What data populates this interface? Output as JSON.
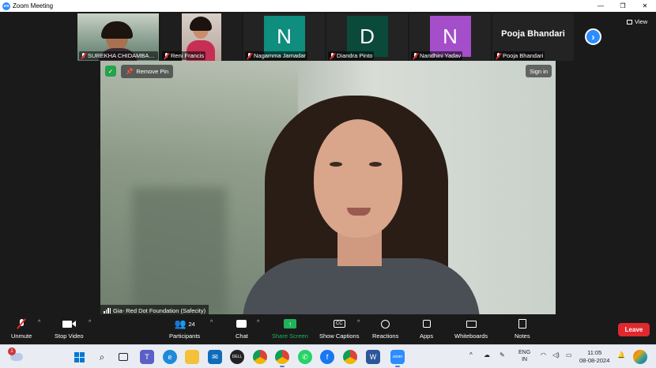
{
  "window": {
    "title": "Zoom Meeting",
    "controls": {
      "minimize": "—",
      "restore": "❐",
      "close": "✕"
    }
  },
  "gallery": {
    "participants": [
      {
        "name": "SUREKHA CHIDAMBAR...",
        "type": "video",
        "muted": true
      },
      {
        "name": "Reni Francis",
        "type": "video",
        "muted": true
      },
      {
        "name": "Nagamma Jamadar",
        "type": "avatar",
        "letter": "N",
        "color": "#0f8d7e",
        "muted": true
      },
      {
        "name": "Diandra Pinto",
        "type": "avatar",
        "letter": "D",
        "color": "#0b4a3a",
        "muted": true
      },
      {
        "name": "Nandhini Yadav",
        "type": "avatar",
        "letter": "N",
        "color": "#a44ec9",
        "muted": true
      },
      {
        "name": "Pooja Bhandari",
        "type": "name",
        "big_name": "Pooja Bhandari",
        "muted": true
      }
    ],
    "view_label": "View",
    "next_icon": "chevron-right-icon"
  },
  "main_video": {
    "remove_pin_label": "Remove Pin",
    "sign_in_label": "Sign in",
    "speaker_name": "Gia- Red Dot Foundation (Safecity)"
  },
  "toolbar": {
    "unmute_label": "Unmute",
    "stop_video_label": "Stop Video",
    "participants_label": "Participants",
    "participants_count": "24",
    "chat_label": "Chat",
    "share_screen_label": "Share Screen",
    "show_captions_label": "Show Captions",
    "cc_text": "CC",
    "reactions_label": "Reactions",
    "apps_label": "Apps",
    "whiteboards_label": "Whiteboards",
    "notes_label": "Notes",
    "leave_label": "Leave",
    "accent_green": "#1fb25a",
    "leave_color": "#e0282e"
  },
  "taskbar": {
    "notification_badge": "1",
    "lang_top": "ENG",
    "lang_bottom": "IN",
    "time": "11:05",
    "date": "08-08-2024",
    "zoom_app_label": "zoom"
  }
}
